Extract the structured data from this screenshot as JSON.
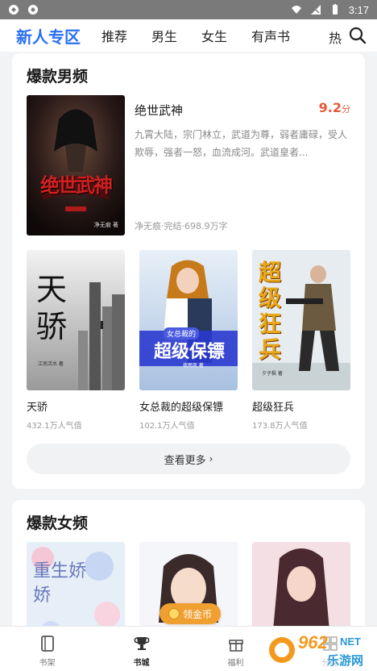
{
  "status_bar": {
    "time": "3:17"
  },
  "tabs": [
    {
      "label": "新人专区",
      "active": true
    },
    {
      "label": "推荐"
    },
    {
      "label": "男生"
    },
    {
      "label": "女生"
    },
    {
      "label": "有声书"
    },
    {
      "label": "热"
    }
  ],
  "search": {
    "icon": "search-icon"
  },
  "male_section": {
    "title": "爆款男频",
    "featured": {
      "title": "绝世武神",
      "score": "9.2",
      "score_unit": "分",
      "desc": "九霄大陆，宗门林立，武道为尊，弱者庸碌，受人欺辱，强者一怒，血流成河。武道皇者...",
      "meta": "净无痕·完结·698.9万字",
      "cover_text": "绝世武神",
      "cover_author": "净无痕 著"
    },
    "books": [
      {
        "title": "天骄",
        "popularity": "432.1万人气值",
        "cover_text": "天骄",
        "cover_author": "江南活水 著"
      },
      {
        "title": "女总裁的超级保镖",
        "popularity": "102.1万人气值",
        "cover_text": "超级保镖",
        "cover_sub": "女总裁的",
        "cover_author": "夜雨风 著"
      },
      {
        "title": "超级狂兵",
        "popularity": "173.8万人气值",
        "cover_text": "超级狂兵",
        "cover_author": "夕子枫 著"
      }
    ],
    "more_label": "查看更多",
    "more_chevron": "›"
  },
  "female_section": {
    "title": "爆款女频",
    "covers": [
      {
        "cover_text": "重生娇娇"
      },
      {
        "cover_text": ""
      },
      {
        "cover_text": ""
      }
    ]
  },
  "gold_pill": {
    "label": "领金币"
  },
  "bottom_nav": [
    {
      "label": "书架",
      "icon": "book-icon"
    },
    {
      "label": "书城",
      "icon": "trophy-icon",
      "active": true
    },
    {
      "label": "福利",
      "icon": "gift-icon"
    },
    {
      "label": "分类",
      "icon": "category-icon"
    }
  ],
  "watermark": {
    "text": "962",
    "sub": "乐游网",
    "net": "NET"
  }
}
